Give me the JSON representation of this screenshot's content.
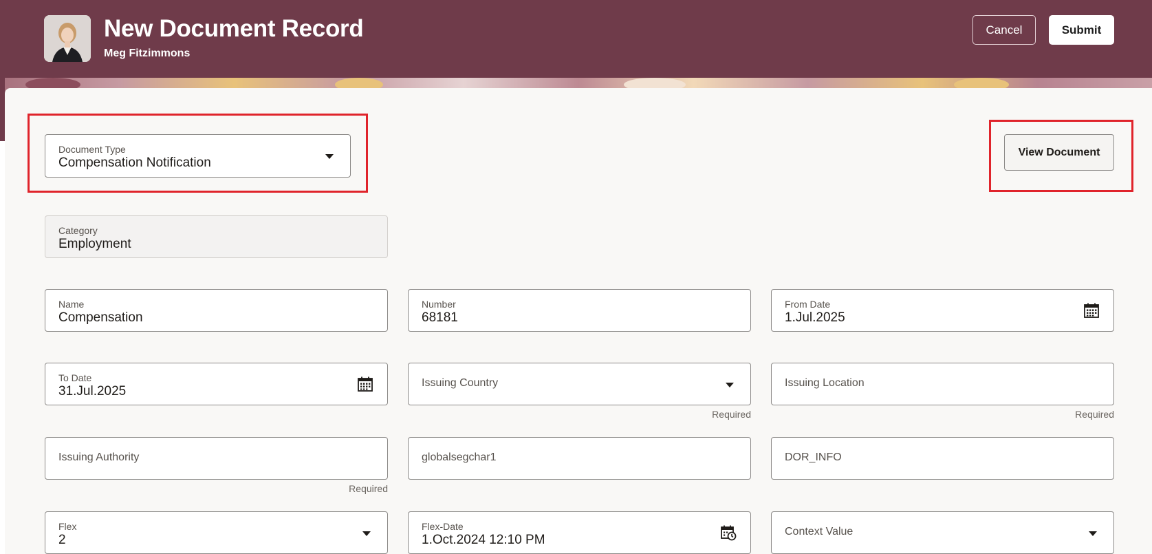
{
  "header": {
    "title": "New Document Record",
    "person_name": "Meg Fitzimmons",
    "cancel_label": "Cancel",
    "submit_label": "Submit",
    "bg_color": "#6f3b4a"
  },
  "form": {
    "document_type": {
      "label": "Document Type",
      "value": "Compensation Notification"
    },
    "view_document_label": "View Document",
    "category": {
      "label": "Category",
      "value": "Employment"
    },
    "name": {
      "label": "Name",
      "value": "Compensation"
    },
    "number": {
      "label": "Number",
      "value": "68181"
    },
    "from_date": {
      "label": "From Date",
      "value": "1.Jul.2025"
    },
    "to_date": {
      "label": "To Date",
      "value": "31.Jul.2025"
    },
    "issuing_country": {
      "placeholder": "Issuing Country",
      "hint": "Required"
    },
    "issuing_location": {
      "placeholder": "Issuing Location",
      "hint": "Required"
    },
    "issuing_authority": {
      "placeholder": "Issuing Authority",
      "hint": "Required"
    },
    "globalsegchar1": {
      "placeholder": "globalsegchar1"
    },
    "dor_info": {
      "placeholder": "DOR_INFO"
    },
    "flex": {
      "label": "Flex",
      "value": "2"
    },
    "flex_date": {
      "label": "Flex-Date",
      "value": "1.Oct.2024 12:10 PM"
    },
    "context_value": {
      "placeholder": "Context Value"
    }
  },
  "icons": {
    "calendar": "calendar-icon",
    "calendar_clock": "calendar-clock-icon",
    "caret": "chevron-down-icon",
    "avatar": "avatar"
  },
  "colors": {
    "highlight": "#e0242b"
  }
}
